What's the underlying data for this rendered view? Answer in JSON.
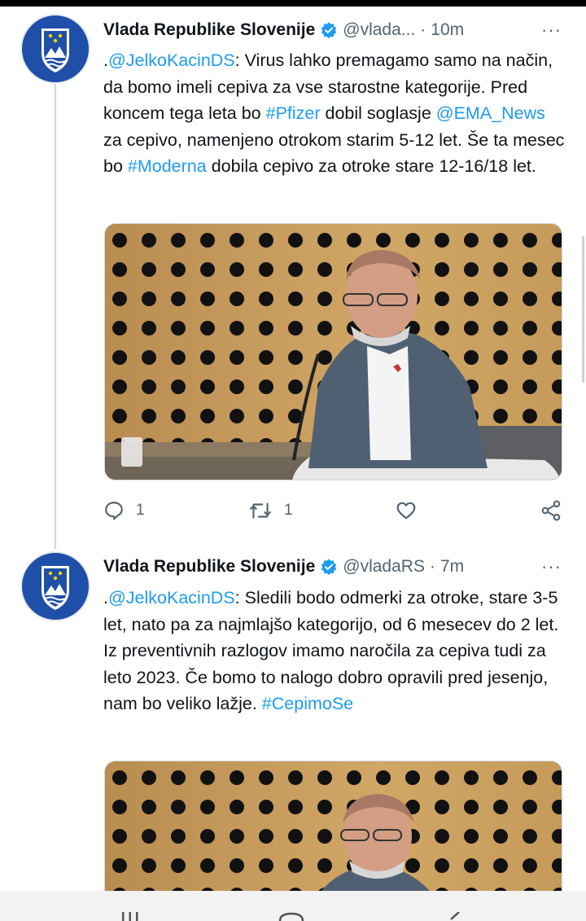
{
  "tweets": [
    {
      "author": "Vlada Republike Slovenije",
      "handle": "@vlada...",
      "separator": "·",
      "time": "10m",
      "more": "···",
      "text_parts": [
        {
          "t": ".",
          "link": false
        },
        {
          "t": "@JelkoKacinDS",
          "link": true
        },
        {
          "t": ": Virus lahko premagamo samo na način, da bomo imeli cepiva za vse starostne kategorije. Pred koncem tega leta bo ",
          "link": false
        },
        {
          "t": "#Pfizer",
          "link": true
        },
        {
          "t": " dobil soglasje ",
          "link": false
        },
        {
          "t": "@EMA_News",
          "link": true
        },
        {
          "t": " za cepivo, namenjeno otrokom starim 5-12 let. Še ta mesec bo ",
          "link": false
        },
        {
          "t": "#Moderna",
          "link": true
        },
        {
          "t": " dobila cepivo za otroke stare 12-16/18 let.",
          "link": false
        }
      ],
      "reply_count": "1",
      "retweet_count": "1"
    },
    {
      "author": "Vlada Republike Slovenije",
      "handle": "@vladaRS",
      "separator": "·",
      "time": "7m",
      "more": "···",
      "text_parts": [
        {
          "t": ".",
          "link": false
        },
        {
          "t": "@JelkoKacinDS",
          "link": true
        },
        {
          "t": ": Sledili bodo odmerki za otroke, stare 3-5 let, nato pa za najmlajšo kategorijo, od 6 mesecev do 2 let. Iz preventivnih razlogov imamo naročila za cepiva tudi za leto 2023. Če bomo to nalogo dobro opravili pred jesenjo, nam bo veliko lažje. ",
          "link": false
        },
        {
          "t": "#CepimoSe",
          "link": true
        }
      ]
    }
  ],
  "icons": {
    "verified": "verified-badge-icon",
    "reply": "reply-icon",
    "retweet": "retweet-icon",
    "like": "heart-icon",
    "share": "share-icon"
  },
  "colors": {
    "link": "#1d9bf0",
    "secondary": "#536471",
    "avatar": "#1f4fa8",
    "panel": "#c49a5e"
  }
}
